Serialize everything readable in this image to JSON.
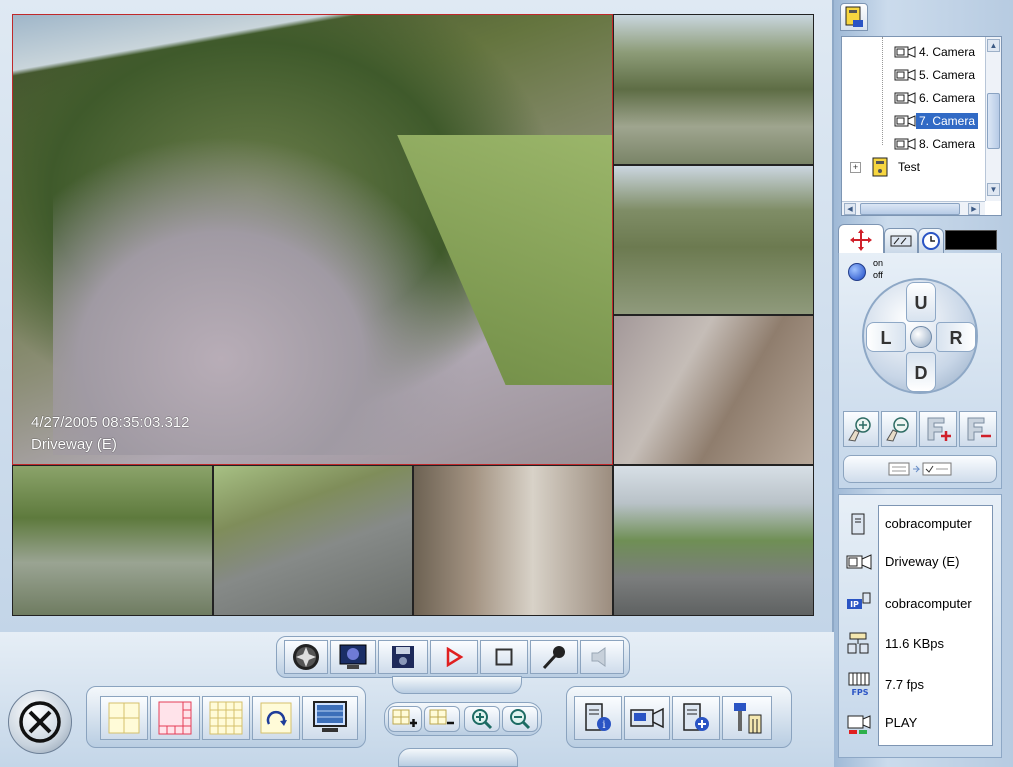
{
  "main_view": {
    "timestamp": "4/27/2005 08:35:03.312",
    "camera_name": "Driveway (E)"
  },
  "camera_tree": {
    "items": [
      {
        "label": "4. Camera"
      },
      {
        "label": "5. Camera"
      },
      {
        "label": "6. Camera"
      },
      {
        "label": "7. Camera",
        "selected": true
      },
      {
        "label": "8. Camera"
      }
    ],
    "group": {
      "label": "Test",
      "expander": "+"
    }
  },
  "ptz": {
    "power_on": "on",
    "power_off": "off",
    "up": "U",
    "down": "D",
    "left": "L",
    "right": "R"
  },
  "status": {
    "computer": "cobracomputer",
    "camera": "Driveway (E)",
    "ip_host": "cobracomputer",
    "bitrate": "11.6 KBps",
    "framerate": "7.7 fps",
    "state": "PLAY"
  },
  "icons": {
    "fps_label": "FPS",
    "ip_label": "IP"
  },
  "colors": {
    "selection": "#316ac5",
    "record": "#e02020",
    "frame": "#c3d5e8"
  }
}
